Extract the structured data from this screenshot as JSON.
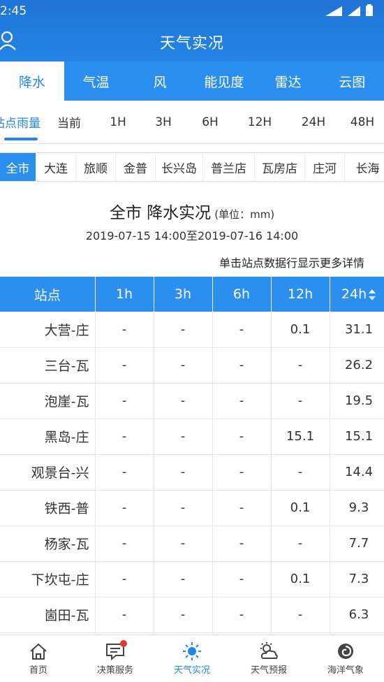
{
  "status": {
    "time": "2:45"
  },
  "header": {
    "title": "天气实况"
  },
  "tabs": [
    {
      "label": "降水",
      "active": true
    },
    {
      "label": "气温"
    },
    {
      "label": "风"
    },
    {
      "label": "能见度"
    },
    {
      "label": "雷达"
    },
    {
      "label": "云图"
    }
  ],
  "time_filters": [
    {
      "label": "站点雨量",
      "active": true
    },
    {
      "label": "当前"
    },
    {
      "label": "1H"
    },
    {
      "label": "3H"
    },
    {
      "label": "6H"
    },
    {
      "label": "12H"
    },
    {
      "label": "24H"
    },
    {
      "label": "48H"
    }
  ],
  "areas": [
    {
      "label": "全市",
      "active": true
    },
    {
      "label": "大连"
    },
    {
      "label": "旅顺"
    },
    {
      "label": "金普"
    },
    {
      "label": "长兴岛"
    },
    {
      "label": "普兰店"
    },
    {
      "label": "瓦房店"
    },
    {
      "label": "庄河"
    },
    {
      "label": "长海"
    }
  ],
  "report": {
    "title": "全市 降水实况",
    "unit": "(单位：mm)",
    "date_range": "2019-07-15 14:00至2019-07-16 14:00",
    "hint": "单击站点数据行显示更多详情"
  },
  "table": {
    "headers": [
      "站点",
      "1h",
      "3h",
      "6h",
      "12h",
      "24h"
    ],
    "rows": [
      [
        "大营-庄",
        "-",
        "-",
        "-",
        "0.1",
        "31.1"
      ],
      [
        "三台-瓦",
        "-",
        "-",
        "-",
        "-",
        "26.2"
      ],
      [
        "泡崖-瓦",
        "-",
        "-",
        "-",
        "-",
        "19.5"
      ],
      [
        "黑岛-庄",
        "-",
        "-",
        "-",
        "15.1",
        "15.1"
      ],
      [
        "观景台-兴",
        "-",
        "-",
        "-",
        "-",
        "14.4"
      ],
      [
        "铁西-普",
        "-",
        "-",
        "-",
        "0.1",
        "9.3"
      ],
      [
        "杨家-瓦",
        "-",
        "-",
        "-",
        "-",
        "7.7"
      ],
      [
        "下坎屯-庄",
        "-",
        "-",
        "-",
        "0.1",
        "7.3"
      ],
      [
        "崮田-瓦",
        "-",
        "-",
        "-",
        "-",
        "6.3"
      ]
    ]
  },
  "bottom_nav": [
    {
      "label": "首页",
      "icon": "home-icon"
    },
    {
      "label": "决策服务",
      "icon": "message-icon",
      "badge": true
    },
    {
      "label": "天气实况",
      "icon": "sun-icon",
      "active": true
    },
    {
      "label": "天气预报",
      "icon": "cloud-sun-icon"
    },
    {
      "label": "海洋气象",
      "icon": "swirl-icon"
    }
  ],
  "colors": {
    "primary": "#2b8fef",
    "header": "#1f73d6",
    "badge": "#e53935"
  }
}
